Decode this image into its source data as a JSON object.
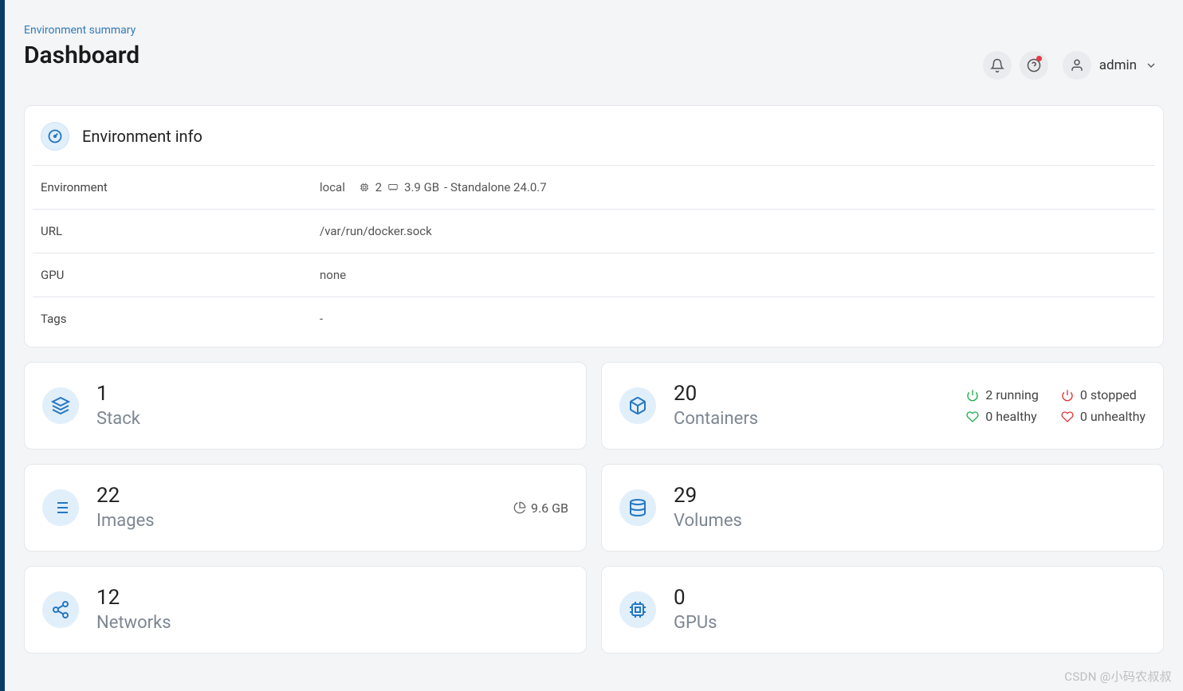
{
  "breadcrumb": "Environment summary",
  "title": "Dashboard",
  "user": {
    "name": "admin"
  },
  "env_panel": {
    "title": "Environment info",
    "rows": {
      "env_label": "Environment",
      "env_name": "local",
      "env_cpu": "2",
      "env_mem": "3.9 GB",
      "env_suffix": " - Standalone 24.0.7",
      "url_label": "URL",
      "url_value": "/var/run/docker.sock",
      "gpu_label": "GPU",
      "gpu_value": "none",
      "tags_label": "Tags",
      "tags_value": "-"
    }
  },
  "tiles": {
    "stack": {
      "count": "1",
      "label": "Stack"
    },
    "containers": {
      "count": "20",
      "label": "Containers",
      "running": "2 running",
      "stopped": "0 stopped",
      "healthy": "0 healthy",
      "unhealthy": "0 unhealthy"
    },
    "images": {
      "count": "22",
      "label": "Images",
      "size": "9.6 GB"
    },
    "volumes": {
      "count": "29",
      "label": "Volumes"
    },
    "networks": {
      "count": "12",
      "label": "Networks"
    },
    "gpus": {
      "count": "0",
      "label": "GPUs"
    }
  },
  "watermark": "CSDN @小码农叔叔"
}
